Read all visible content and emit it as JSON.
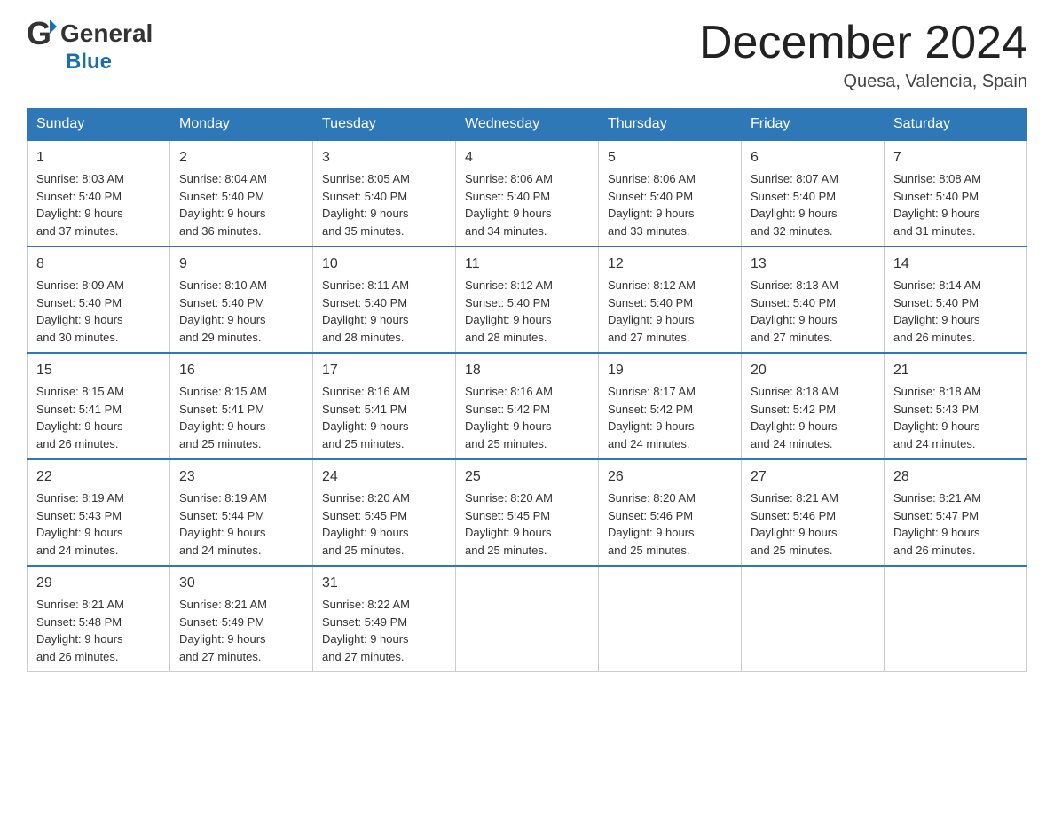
{
  "header": {
    "logo_general": "General",
    "logo_blue": "Blue",
    "title": "December 2024",
    "location": "Quesa, Valencia, Spain"
  },
  "days_of_week": [
    "Sunday",
    "Monday",
    "Tuesday",
    "Wednesday",
    "Thursday",
    "Friday",
    "Saturday"
  ],
  "weeks": [
    [
      {
        "day": "1",
        "sunrise": "8:03 AM",
        "sunset": "5:40 PM",
        "daylight": "9 hours and 37 minutes."
      },
      {
        "day": "2",
        "sunrise": "8:04 AM",
        "sunset": "5:40 PM",
        "daylight": "9 hours and 36 minutes."
      },
      {
        "day": "3",
        "sunrise": "8:05 AM",
        "sunset": "5:40 PM",
        "daylight": "9 hours and 35 minutes."
      },
      {
        "day": "4",
        "sunrise": "8:06 AM",
        "sunset": "5:40 PM",
        "daylight": "9 hours and 34 minutes."
      },
      {
        "day": "5",
        "sunrise": "8:06 AM",
        "sunset": "5:40 PM",
        "daylight": "9 hours and 33 minutes."
      },
      {
        "day": "6",
        "sunrise": "8:07 AM",
        "sunset": "5:40 PM",
        "daylight": "9 hours and 32 minutes."
      },
      {
        "day": "7",
        "sunrise": "8:08 AM",
        "sunset": "5:40 PM",
        "daylight": "9 hours and 31 minutes."
      }
    ],
    [
      {
        "day": "8",
        "sunrise": "8:09 AM",
        "sunset": "5:40 PM",
        "daylight": "9 hours and 30 minutes."
      },
      {
        "day": "9",
        "sunrise": "8:10 AM",
        "sunset": "5:40 PM",
        "daylight": "9 hours and 29 minutes."
      },
      {
        "day": "10",
        "sunrise": "8:11 AM",
        "sunset": "5:40 PM",
        "daylight": "9 hours and 28 minutes."
      },
      {
        "day": "11",
        "sunrise": "8:12 AM",
        "sunset": "5:40 PM",
        "daylight": "9 hours and 28 minutes."
      },
      {
        "day": "12",
        "sunrise": "8:12 AM",
        "sunset": "5:40 PM",
        "daylight": "9 hours and 27 minutes."
      },
      {
        "day": "13",
        "sunrise": "8:13 AM",
        "sunset": "5:40 PM",
        "daylight": "9 hours and 27 minutes."
      },
      {
        "day": "14",
        "sunrise": "8:14 AM",
        "sunset": "5:40 PM",
        "daylight": "9 hours and 26 minutes."
      }
    ],
    [
      {
        "day": "15",
        "sunrise": "8:15 AM",
        "sunset": "5:41 PM",
        "daylight": "9 hours and 26 minutes."
      },
      {
        "day": "16",
        "sunrise": "8:15 AM",
        "sunset": "5:41 PM",
        "daylight": "9 hours and 25 minutes."
      },
      {
        "day": "17",
        "sunrise": "8:16 AM",
        "sunset": "5:41 PM",
        "daylight": "9 hours and 25 minutes."
      },
      {
        "day": "18",
        "sunrise": "8:16 AM",
        "sunset": "5:42 PM",
        "daylight": "9 hours and 25 minutes."
      },
      {
        "day": "19",
        "sunrise": "8:17 AM",
        "sunset": "5:42 PM",
        "daylight": "9 hours and 24 minutes."
      },
      {
        "day": "20",
        "sunrise": "8:18 AM",
        "sunset": "5:42 PM",
        "daylight": "9 hours and 24 minutes."
      },
      {
        "day": "21",
        "sunrise": "8:18 AM",
        "sunset": "5:43 PM",
        "daylight": "9 hours and 24 minutes."
      }
    ],
    [
      {
        "day": "22",
        "sunrise": "8:19 AM",
        "sunset": "5:43 PM",
        "daylight": "9 hours and 24 minutes."
      },
      {
        "day": "23",
        "sunrise": "8:19 AM",
        "sunset": "5:44 PM",
        "daylight": "9 hours and 24 minutes."
      },
      {
        "day": "24",
        "sunrise": "8:20 AM",
        "sunset": "5:45 PM",
        "daylight": "9 hours and 25 minutes."
      },
      {
        "day": "25",
        "sunrise": "8:20 AM",
        "sunset": "5:45 PM",
        "daylight": "9 hours and 25 minutes."
      },
      {
        "day": "26",
        "sunrise": "8:20 AM",
        "sunset": "5:46 PM",
        "daylight": "9 hours and 25 minutes."
      },
      {
        "day": "27",
        "sunrise": "8:21 AM",
        "sunset": "5:46 PM",
        "daylight": "9 hours and 25 minutes."
      },
      {
        "day": "28",
        "sunrise": "8:21 AM",
        "sunset": "5:47 PM",
        "daylight": "9 hours and 26 minutes."
      }
    ],
    [
      {
        "day": "29",
        "sunrise": "8:21 AM",
        "sunset": "5:48 PM",
        "daylight": "9 hours and 26 minutes."
      },
      {
        "day": "30",
        "sunrise": "8:21 AM",
        "sunset": "5:49 PM",
        "daylight": "9 hours and 27 minutes."
      },
      {
        "day": "31",
        "sunrise": "8:22 AM",
        "sunset": "5:49 PM",
        "daylight": "9 hours and 27 minutes."
      },
      null,
      null,
      null,
      null
    ]
  ],
  "labels": {
    "sunrise": "Sunrise:",
    "sunset": "Sunset:",
    "daylight": "Daylight:"
  }
}
